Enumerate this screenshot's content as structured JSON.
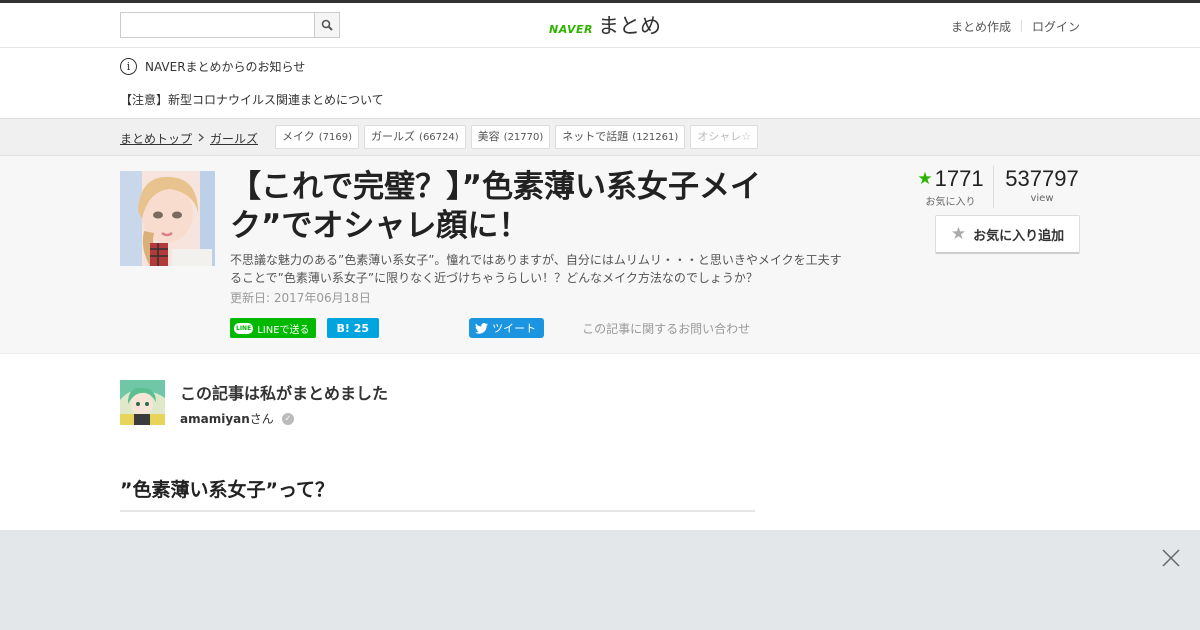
{
  "header": {
    "search_placeholder": "",
    "logo_naver": "NAVER",
    "logo_matome": "まとめ",
    "create_link": "まとめ作成",
    "login_link": "ログイン"
  },
  "notice": {
    "title": "NAVERまとめからのお知らせ",
    "link": "【注意】新型コロナウイルス関連まとめについて"
  },
  "breadcrumb": {
    "items": [
      "まとめトップ",
      "ガールズ"
    ]
  },
  "tags": [
    {
      "label": "メイク",
      "count": "(7169)"
    },
    {
      "label": "ガールズ",
      "count": "(66724)"
    },
    {
      "label": "美容",
      "count": "(21770)"
    },
    {
      "label": "ネットで話題",
      "count": "(121261)"
    },
    {
      "label": "オシャレ☆",
      "count": ""
    }
  ],
  "article": {
    "title": "【これで完璧？】”色素薄い系女子メイク”でオシャレ顔に！",
    "description": "不思議な魅力のある”色素薄い系女子”。憧れではありますが、自分にはムリムリ・・・と思いきやメイクを工夫することで”色素薄い系女子”に限りなく近づけちゃうらしい！？どんなメイク方法なのでしょうか？",
    "updated": "更新日: 2017年06月18日"
  },
  "share": {
    "line_icon": "LINE",
    "line_label": "LINEで送る",
    "hatena_label": "B!",
    "hatena_count": "25",
    "tweet_label": "ツイート",
    "contact_label": "この記事に関するお問い合わせ"
  },
  "stats": {
    "favorites": "1771",
    "favorites_label": "お気に入り",
    "views": "537797",
    "views_label": "view"
  },
  "fav_button": {
    "label": "お気に入り追加"
  },
  "author": {
    "heading": "この記事は私がまとめました",
    "name": "amamiyan",
    "suffix": "さん"
  },
  "section": {
    "title": "”色素薄い系女子”って？"
  },
  "colors": {
    "naver_green": "#2db400",
    "line_green": "#00b900",
    "hatena_blue": "#00a4de",
    "twitter_blue": "#1b95e0"
  }
}
